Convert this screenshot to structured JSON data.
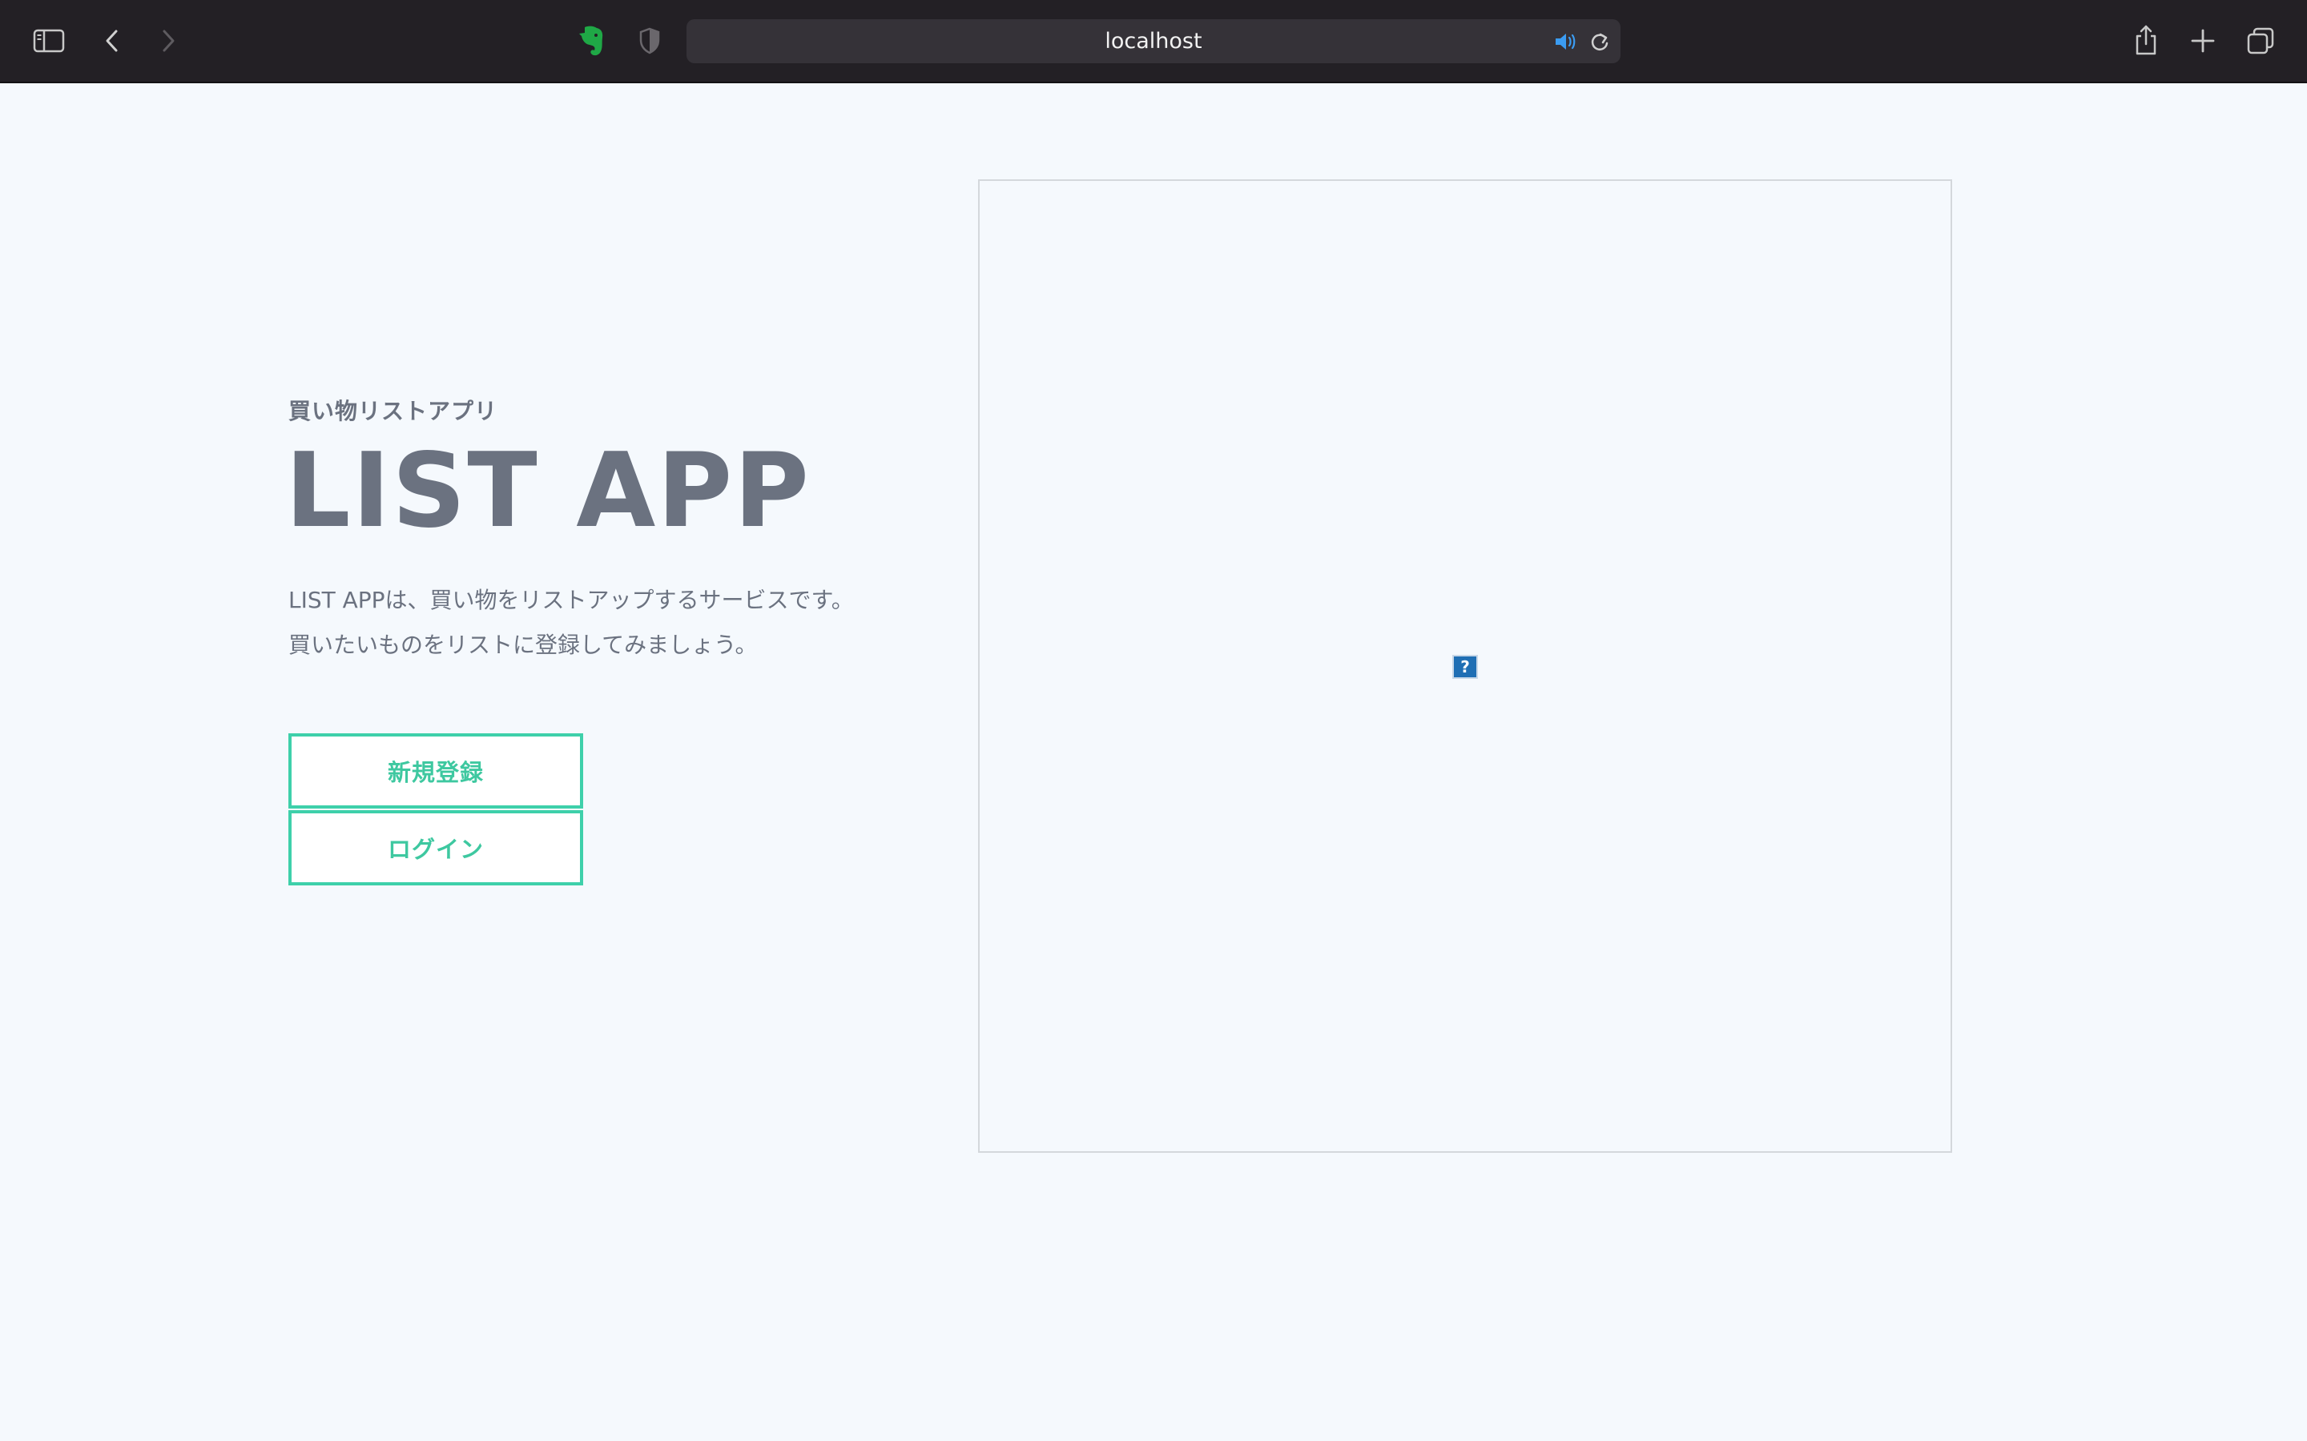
{
  "browser": {
    "url": "localhost",
    "icons": {
      "sidebar": "sidebar-icon",
      "back": "chevron-left-icon",
      "forward": "chevron-right-icon",
      "extension": "evernote-icon",
      "privacy": "shield-icon",
      "audio": "speaker-icon",
      "reload": "reload-icon",
      "share": "share-icon",
      "new_tab": "plus-icon",
      "tabs": "tab-overview-icon"
    },
    "colors": {
      "toolbar": "#232025",
      "address_bar": "#353238",
      "evernote": "#1fa846",
      "audio": "#3b9cf2"
    }
  },
  "hero": {
    "subtitle": "買い物リストアプリ",
    "title": "LIST APP",
    "description_line1": "LIST APPは、買い物をリストアップするサービスです。",
    "description_line2": "買いたいものをリストに登録してみましょう。"
  },
  "actions": {
    "register_label": "新規登録",
    "login_label": "ログイン"
  },
  "image": {
    "broken_glyph": "?"
  },
  "colors": {
    "page_background": "#f5f9fd",
    "text": "#6b7280",
    "accent": "#3ed0aa"
  }
}
